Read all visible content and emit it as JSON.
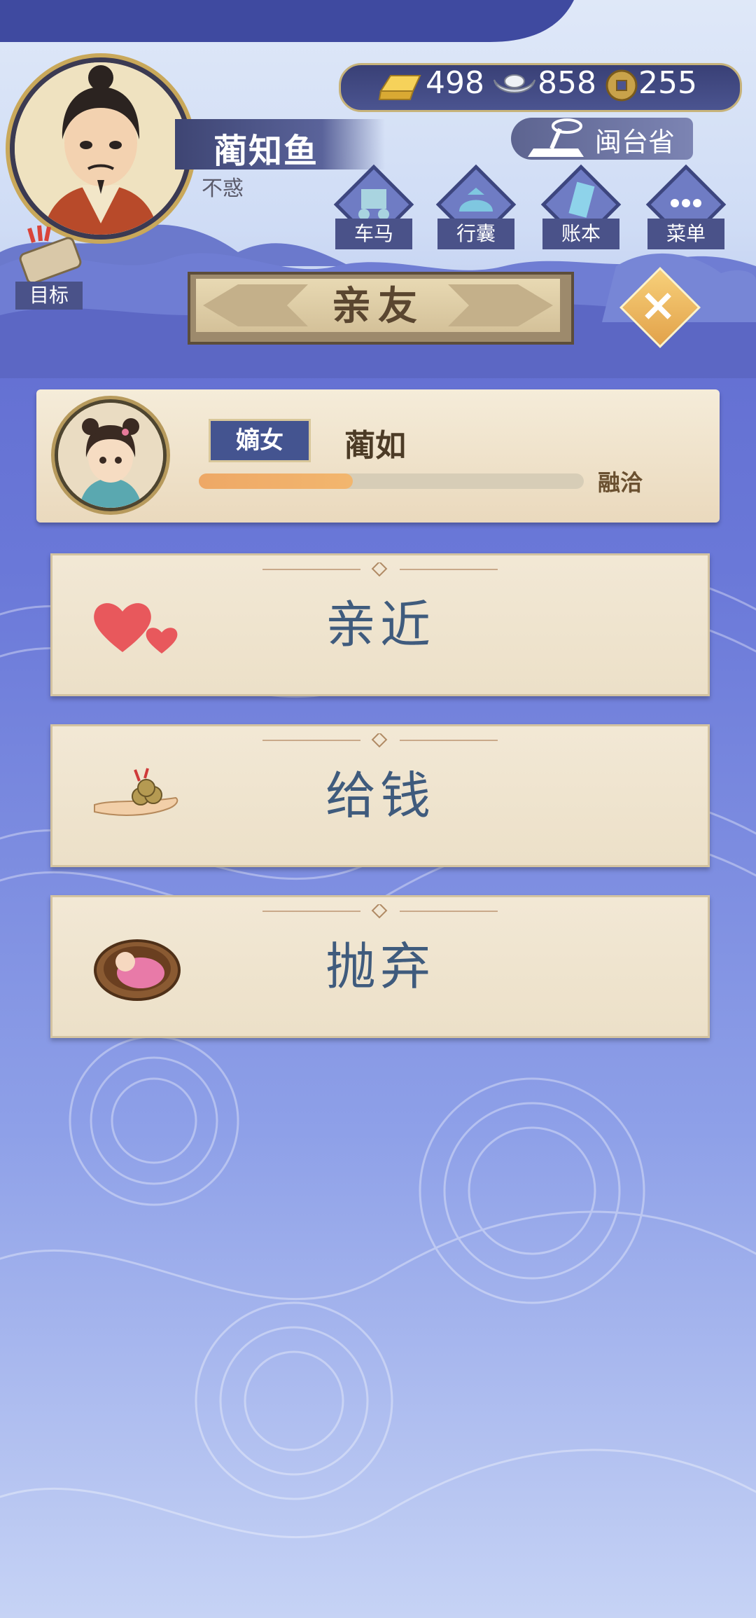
{
  "player": {
    "name": "蔺知鱼",
    "age_label": "不惑"
  },
  "resources": [
    {
      "icon": "gold-ingot-icon",
      "value": "498"
    },
    {
      "icon": "silver-ingot-icon",
      "value": "858"
    },
    {
      "icon": "copper-coin-icon",
      "value": "255"
    }
  ],
  "location": "闽台省",
  "nav": [
    {
      "label": "车马",
      "icon": "carriage-icon"
    },
    {
      "label": "行囊",
      "icon": "bundle-icon"
    },
    {
      "label": "账本",
      "icon": "ledger-icon"
    },
    {
      "label": "菜单",
      "icon": "more-icon"
    }
  ],
  "goal_label": "目标",
  "page_title": "亲友",
  "friend": {
    "relation_tag": "嫡女",
    "name": "蔺如",
    "affinity_fraction": 0.4,
    "status": "融洽"
  },
  "actions": [
    {
      "label": "亲近",
      "icon": "hearts-icon"
    },
    {
      "label": "给钱",
      "icon": "money-hand-icon"
    },
    {
      "label": "抛弃",
      "icon": "baby-basket-icon"
    }
  ],
  "colors": {
    "background_top": "#5a63c8",
    "background_bottom": "#c6d3f5",
    "accent_gold": "#c9a85a",
    "nav_label_bg": "#4a5289",
    "action_text": "#3f5b7d",
    "affinity_fill": "#eea866"
  }
}
